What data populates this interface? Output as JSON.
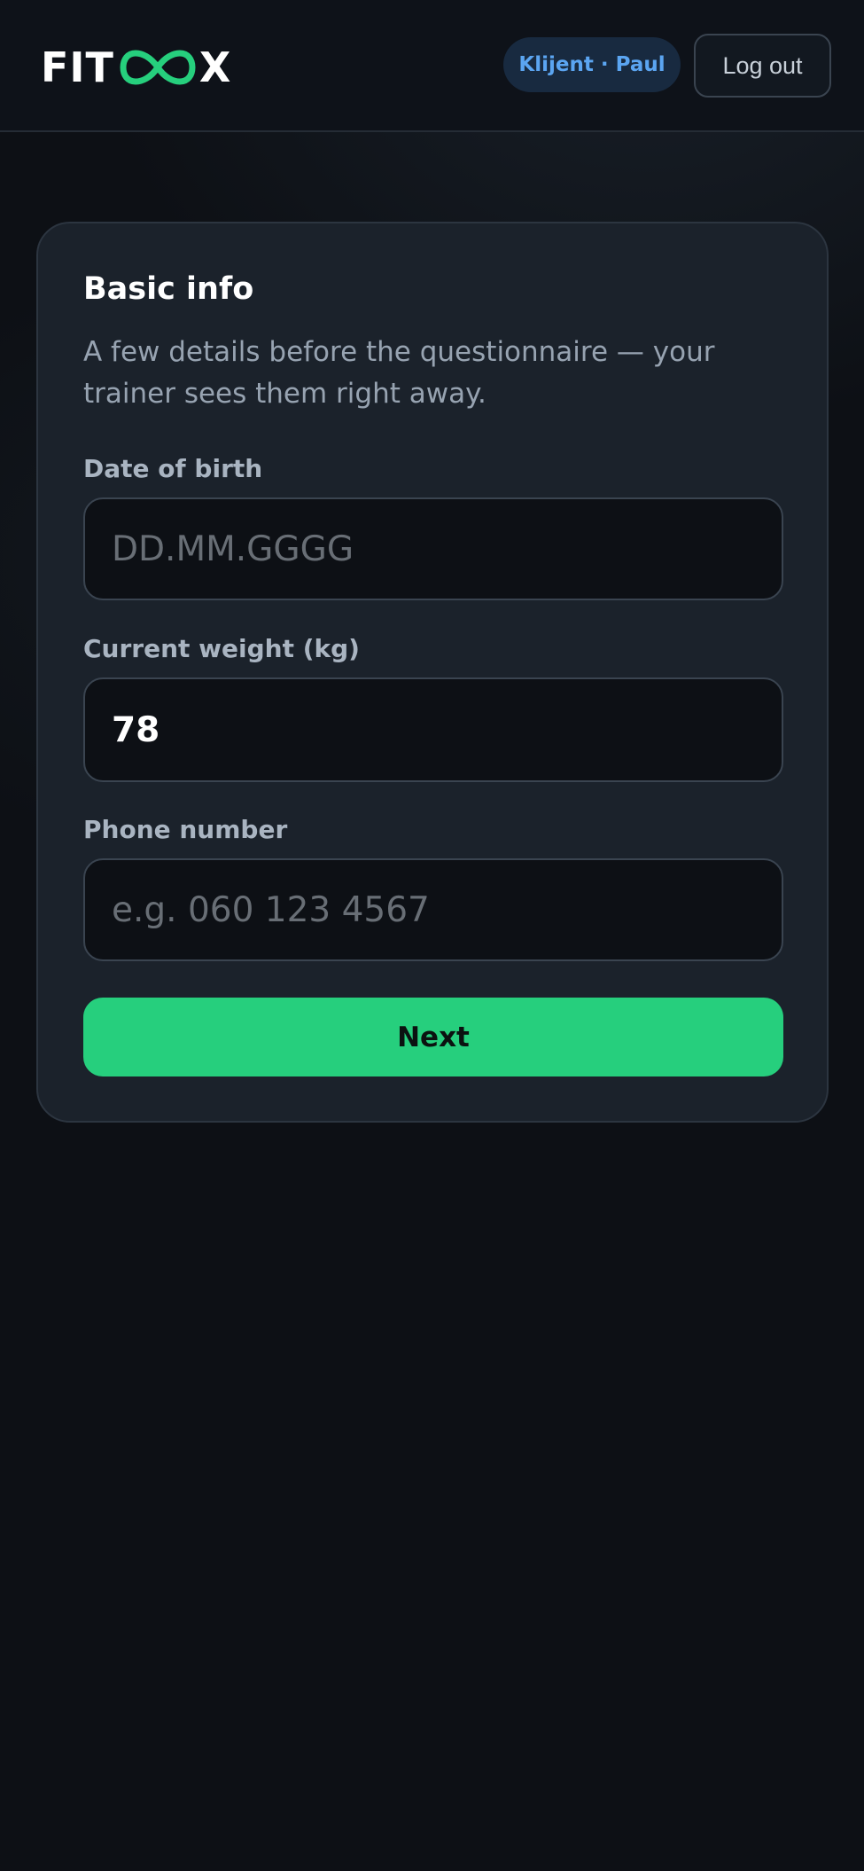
{
  "header": {
    "logo_left": "FIT",
    "logo_right": "X",
    "logo_icon": "infinity-icon",
    "role_chip": "Klijent · Paul",
    "logout_label": "Log out"
  },
  "form": {
    "title": "Basic info",
    "description": "A few details before the questionnaire — your trainer sees them right away.",
    "fields": [
      {
        "label": "Date of birth",
        "placeholder": "DD.MM.GGGG",
        "value": ""
      },
      {
        "label": "Current weight (kg)",
        "placeholder": "",
        "value": "78"
      },
      {
        "label": "Phone number",
        "placeholder": "e.g. 060 123 4567",
        "value": ""
      }
    ],
    "submit_label": "Next"
  },
  "colors": {
    "accent": "#26cf7d",
    "chip_text": "#5ba5f1",
    "background": "#0d1015",
    "card": "#1b222b"
  }
}
